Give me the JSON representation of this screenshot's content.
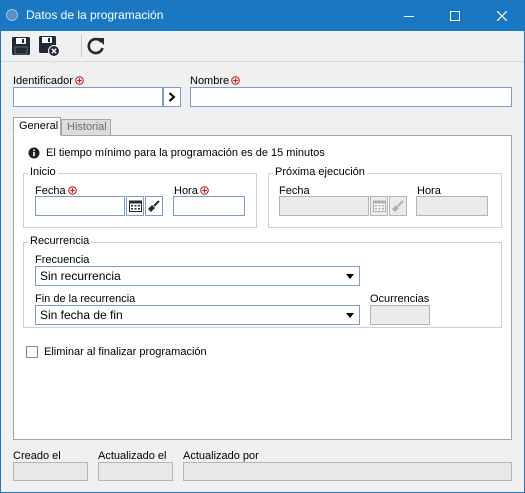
{
  "window": {
    "title": "Datos de la programación",
    "accent": "#1a78c2"
  },
  "toolbar": {
    "save_icon": "floppy-disk-icon",
    "save_close_icon": "floppy-disk-close-icon",
    "refresh_icon": "refresh-icon"
  },
  "form": {
    "identifier_label": "Identificador",
    "identifier_value": "",
    "name_label": "Nombre",
    "name_value": ""
  },
  "tabs": [
    {
      "label": "General",
      "active": true
    },
    {
      "label": "Historial",
      "active": false
    }
  ],
  "general": {
    "info_text": "El tiempo mínimo para la programación es de 15 minutos",
    "inicio": {
      "title": "Inicio",
      "date_label": "Fecha",
      "date_value": "",
      "time_label": "Hora",
      "time_value": ""
    },
    "proxima": {
      "title": "Próxima ejecución",
      "date_label": "Fecha",
      "date_value": "",
      "time_label": "Hora",
      "time_value": ""
    },
    "recurrencia": {
      "title": "Recurrencia",
      "frequency_label": "Frecuencia",
      "frequency_value": "Sin recurrencia",
      "end_label": "Fin de la recurrencia",
      "end_value": "Sin fecha de fin",
      "occurrences_label": "Ocurrencias",
      "occurrences_value": ""
    },
    "delete_checkbox_label": "Eliminar al finalizar programación",
    "delete_checked": false
  },
  "footer": {
    "created_label": "Creado el",
    "created_value": "",
    "updated_label": "Actualizado el",
    "updated_value": "",
    "updated_by_label": "Actualizado por",
    "updated_by_value": ""
  },
  "colors": {
    "required": "#d02020",
    "field_border": "#7a9cc6",
    "disabled_bg": "#ebebeb"
  }
}
